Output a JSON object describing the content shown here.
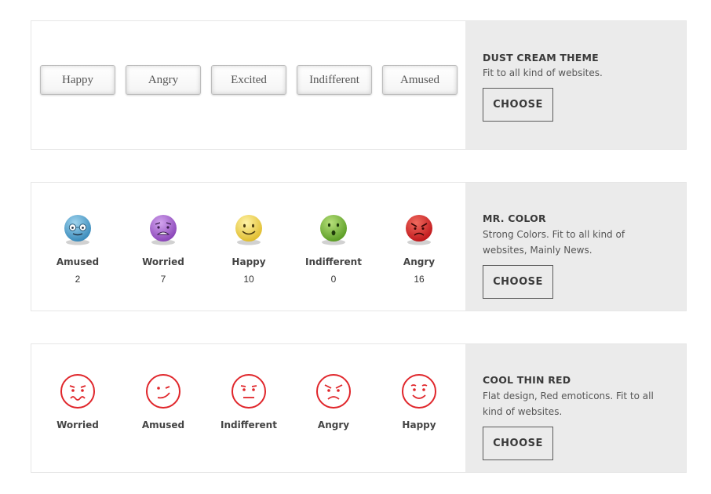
{
  "themes": [
    {
      "title": "DUST CREAM THEME",
      "description": "Fit to all kind of websites.",
      "choose_label": "CHOOSE",
      "buttons": [
        "Happy",
        "Angry",
        "Excited",
        "Indifferent",
        "Amused"
      ]
    },
    {
      "title": "MR. COLOR",
      "description": "Strong Colors. Fit to all kind of websites, Mainly News.",
      "choose_label": "CHOOSE",
      "items": [
        {
          "label": "Amused",
          "count": "2",
          "icon": "amused-blue-emoticon-icon",
          "color": "#5aa7cf"
        },
        {
          "label": "Worried",
          "count": "7",
          "icon": "worried-purple-emoticon-icon",
          "color": "#a062c9"
        },
        {
          "label": "Happy",
          "count": "10",
          "icon": "happy-yellow-emoticon-icon",
          "color": "#eed34f"
        },
        {
          "label": "Indifferent",
          "count": "0",
          "icon": "indifferent-green-emoticon-icon",
          "color": "#78b836"
        },
        {
          "label": "Angry",
          "count": "16",
          "icon": "angry-red-emoticon-icon",
          "color": "#d62a2a"
        }
      ]
    },
    {
      "title": "COOL THIN RED",
      "description": "Flat design, Red emoticons. Fit to all kind of websites.",
      "choose_label": "CHOOSE",
      "items": [
        {
          "label": "Worried",
          "icon": "worried-red-outline-icon"
        },
        {
          "label": "Amused",
          "icon": "amused-red-outline-icon"
        },
        {
          "label": "Indifferent",
          "icon": "indifferent-red-outline-icon"
        },
        {
          "label": "Angry",
          "icon": "angry-red-outline-icon"
        },
        {
          "label": "Happy",
          "icon": "happy-red-outline-icon"
        }
      ],
      "accent": "#e0262b"
    }
  ]
}
